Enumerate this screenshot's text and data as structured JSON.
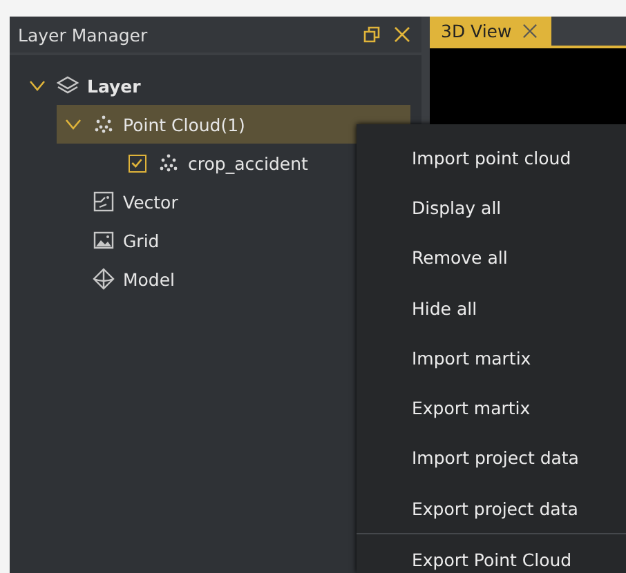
{
  "layer_panel": {
    "title": "Layer Manager",
    "tree": [
      {
        "label": "Layer",
        "kind": "layers",
        "expanded": true,
        "children": [
          {
            "label": "Point Cloud(1)",
            "kind": "points",
            "expanded": true,
            "selected": true,
            "children": [
              {
                "label": "crop_accident",
                "kind": "points",
                "checked": true,
                "selected": false
              }
            ]
          },
          {
            "label": "Vector",
            "kind": "vector",
            "selected": false
          },
          {
            "label": "Grid",
            "kind": "grid",
            "selected": false
          },
          {
            "label": "Model",
            "kind": "model",
            "selected": false
          }
        ]
      }
    ]
  },
  "tabs": [
    {
      "label": "3D View",
      "selected": true
    }
  ],
  "context_menu": [
    {
      "kind": "item",
      "label": "Import point cloud"
    },
    {
      "kind": "item",
      "label": "Display all"
    },
    {
      "kind": "item",
      "label": "Remove all"
    },
    {
      "kind": "item",
      "label": "Hide all"
    },
    {
      "kind": "item",
      "label": "Import martix"
    },
    {
      "kind": "item",
      "label": "Export martix"
    },
    {
      "kind": "item",
      "label": "Import project data"
    },
    {
      "kind": "item",
      "label": "Export project data"
    },
    {
      "kind": "separator"
    },
    {
      "kind": "item",
      "label": "Export Point Cloud"
    }
  ]
}
